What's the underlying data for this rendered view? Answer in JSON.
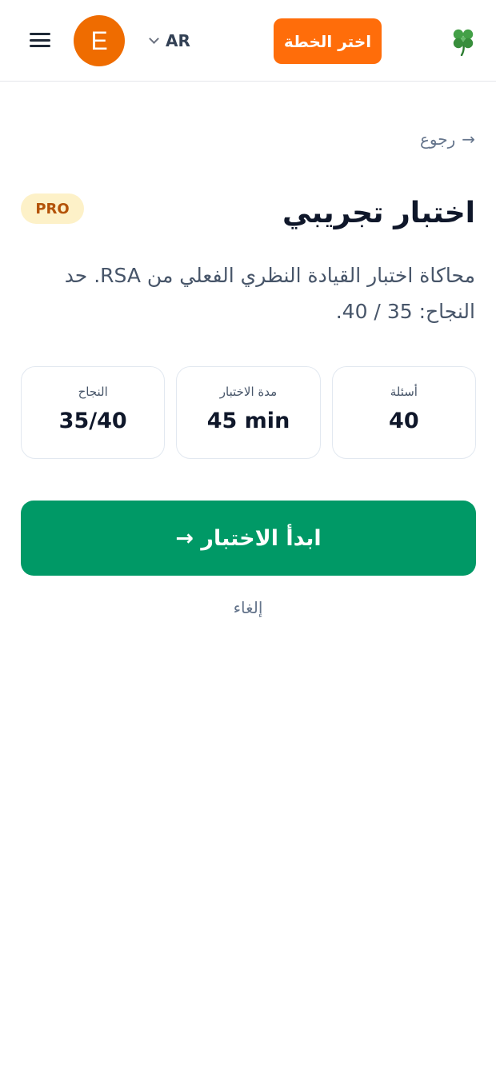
{
  "header": {
    "avatar_initial": "E",
    "language": "AR",
    "plan_button_label": "اختر الخطة",
    "logo_icon": "four-leaf-clover-icon"
  },
  "page": {
    "back_label": "رجوع",
    "back_arrow": "→",
    "title": "اختبار تجريبي",
    "badge": "PRO",
    "description": "محاكاة اختبار القيادة النظري الفعلي من RSA. حد النجاح: 35 / 40."
  },
  "stats": [
    {
      "label": "أسئلة",
      "value": "40"
    },
    {
      "label": "مدة الاختبار",
      "value": "45 min"
    },
    {
      "label": "النجاح",
      "value": "35/40"
    }
  ],
  "actions": {
    "start_label": "ابدأ الاختبار →",
    "cancel_label": "إلغاء"
  },
  "colors": {
    "accent_orange": "#ff6d0a",
    "avatar_orange": "#ef6c00",
    "primary_green": "#009966",
    "badge_bg": "#fdf1c8",
    "badge_text": "#b45309"
  }
}
